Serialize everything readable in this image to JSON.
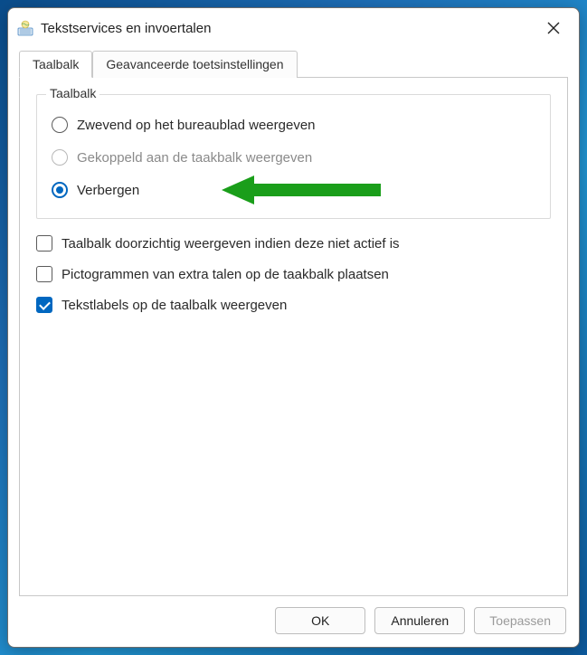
{
  "window": {
    "title": "Tekstservices en invoertalen"
  },
  "tabs": [
    {
      "label": "Taalbalk",
      "active": true
    },
    {
      "label": "Geavanceerde toetsinstellingen",
      "active": false
    }
  ],
  "groupbox": {
    "legend": "Taalbalk",
    "radios": [
      {
        "label": "Zwevend op het bureaublad weergeven",
        "selected": false,
        "disabled": false
      },
      {
        "label": "Gekoppeld aan de taakbalk weergeven",
        "selected": false,
        "disabled": true
      },
      {
        "label": "Verbergen",
        "selected": true,
        "disabled": false
      }
    ]
  },
  "checkboxes": [
    {
      "label": "Taalbalk doorzichtig weergeven indien deze niet actief is",
      "checked": false
    },
    {
      "label": "Pictogrammen van extra talen op de taakbalk plaatsen",
      "checked": false
    },
    {
      "label": "Tekstlabels op de taalbalk weergeven",
      "checked": true
    }
  ],
  "buttons": {
    "ok": "OK",
    "cancel": "Annuleren",
    "apply": "Toepassen"
  },
  "annotation": {
    "arrow_color": "#1a9e1a"
  }
}
